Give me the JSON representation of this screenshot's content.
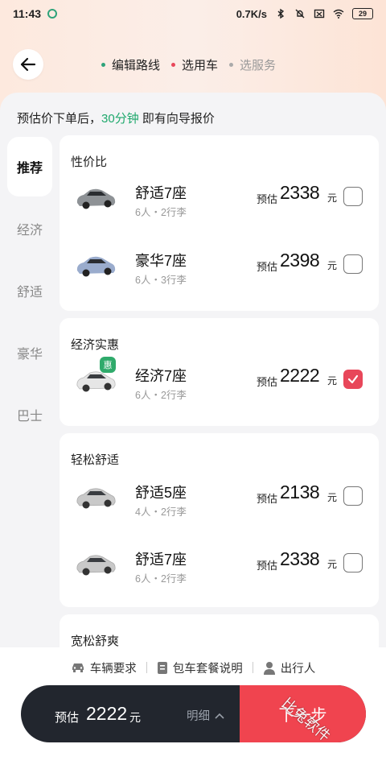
{
  "status_bar": {
    "time": "11:43",
    "net_speed": "0.7K/s",
    "battery": "29"
  },
  "steps": [
    {
      "label": "编辑路线",
      "color": "#2fa37a"
    },
    {
      "label": "选用车",
      "color": "#e8475a"
    },
    {
      "label": "选服务",
      "color": "#aaaaaa"
    }
  ],
  "notice": {
    "prefix": "预估价下单后，",
    "highlight": "30分钟",
    "suffix": " 即有向导报价"
  },
  "nav": [
    {
      "label": "推荐",
      "active": true
    },
    {
      "label": "经济"
    },
    {
      "label": "舒适"
    },
    {
      "label": "豪华"
    },
    {
      "label": "巴士"
    }
  ],
  "cards": [
    {
      "title": "性价比",
      "rows": [
        {
          "name": "舒适7座",
          "sub": "6人・2行李",
          "price_label": "预估",
          "price": "2338",
          "unit": "元",
          "checked": false
        },
        {
          "name": "豪华7座",
          "sub": "6人・3行李",
          "price_label": "预估",
          "price": "2398",
          "unit": "元",
          "checked": false
        }
      ]
    },
    {
      "title": "经济实惠",
      "rows": [
        {
          "name": "经济7座",
          "sub": "6人・2行李",
          "price_label": "预估",
          "price": "2222",
          "unit": "元",
          "checked": true,
          "badge": "惠"
        }
      ]
    },
    {
      "title": "轻松舒适",
      "rows": [
        {
          "name": "舒适5座",
          "sub": "4人・2行李",
          "price_label": "预估",
          "price": "2138",
          "unit": "元",
          "checked": false
        },
        {
          "name": "舒适7座",
          "sub": "6人・2行李",
          "price_label": "预估",
          "price": "2338",
          "unit": "元",
          "checked": false
        }
      ]
    },
    {
      "title": "宽松舒爽",
      "rows": []
    }
  ],
  "bottom_links": [
    {
      "label": "车辆要求",
      "icon": "car-icon"
    },
    {
      "label": "包车套餐说明",
      "icon": "document-icon"
    },
    {
      "label": "出行人",
      "icon": "person-icon"
    }
  ],
  "book_bar": {
    "price_label": "预估",
    "price": "2222",
    "unit": "元",
    "detail": "明细",
    "next": "下一步"
  },
  "watermark": "比兔软件",
  "colors": {
    "accent_red": "#e8475a",
    "accent_green": "#1ea86c",
    "dark_bar": "#22262e",
    "next_button": "#f0444f"
  }
}
